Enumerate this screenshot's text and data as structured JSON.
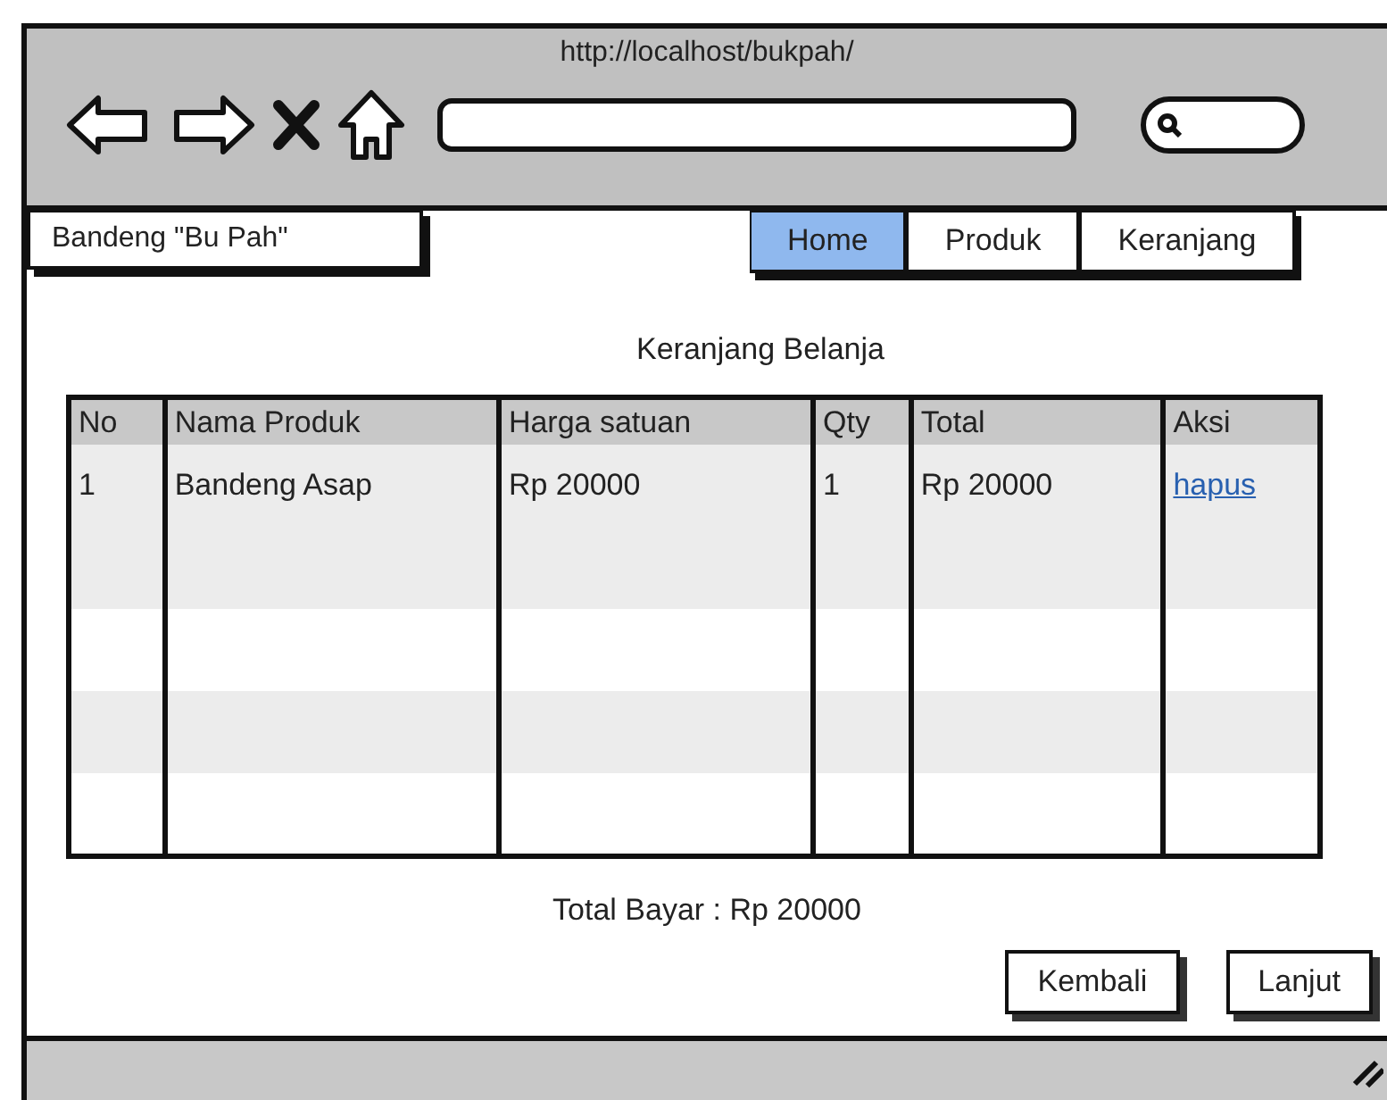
{
  "browser": {
    "url": "http://localhost/bukpah/"
  },
  "brand": "Bandeng \"Bu Pah\"",
  "tabs": [
    {
      "label": "Home",
      "selected": true
    },
    {
      "label": "Produk",
      "selected": false
    },
    {
      "label": "Keranjang",
      "selected": false
    }
  ],
  "heading": "Keranjang Belanja",
  "table": {
    "columns": [
      "No",
      "Nama Produk",
      "Harga satuan",
      "Qty",
      "Total",
      "Aksi"
    ],
    "rows": [
      [
        "1",
        "Bandeng Asap",
        "Rp 20000",
        "1",
        "Rp 20000",
        "hapus"
      ]
    ]
  },
  "total": "Total Bayar : Rp 20000",
  "buttons": [
    "Kembali",
    "Lanjut"
  ]
}
